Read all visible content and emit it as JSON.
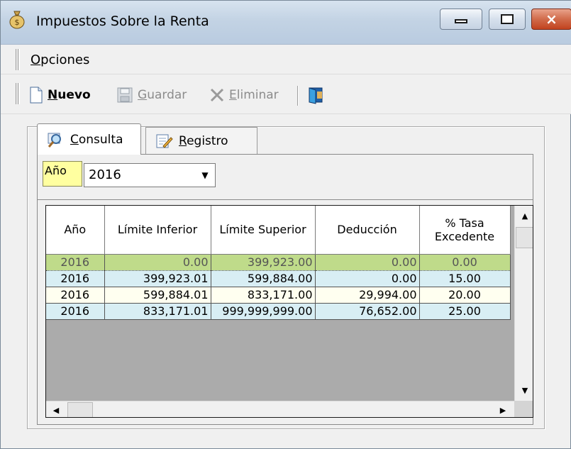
{
  "window": {
    "title": "Impuestos Sobre la Renta",
    "close_glyph": "×"
  },
  "menu": {
    "opciones": {
      "first": "O",
      "rest": "pciones"
    }
  },
  "toolbar": {
    "nuevo": {
      "first": "N",
      "rest": "uevo"
    },
    "guardar": {
      "first": "G",
      "rest": "uardar"
    },
    "eliminar": {
      "first": "E",
      "rest": "liminar"
    }
  },
  "tabs": {
    "consulta": {
      "first": "C",
      "rest": "onsulta"
    },
    "registro": {
      "first": "R",
      "rest": "egistro"
    }
  },
  "filter": {
    "label": "Año",
    "value": "2016",
    "arrow": "▼"
  },
  "grid": {
    "columns": [
      "Año",
      "Límite Inferior",
      "Límite Superior",
      "Deducción",
      "% Tasa Excedente"
    ],
    "rows": [
      [
        "2016",
        "0.00",
        "399,923.00",
        "0.00",
        "0.00"
      ],
      [
        "2016",
        "399,923.01",
        "599,884.00",
        "0.00",
        "15.00"
      ],
      [
        "2016",
        "599,884.01",
        "833,171.00",
        "29,994.00",
        "20.00"
      ],
      [
        "2016",
        "833,171.01",
        "999,999,999.00",
        "76,652.00",
        "25.00"
      ]
    ],
    "scroll": {
      "up": "▲",
      "down": "▼",
      "left": "◀",
      "right": "▶"
    }
  },
  "colors": {
    "selected_row": "#bfdb8a",
    "alt_row_blue": "#d8eef4",
    "alt_row_yellow": "#fffff0",
    "year_label_bg": "#ffffa0"
  }
}
